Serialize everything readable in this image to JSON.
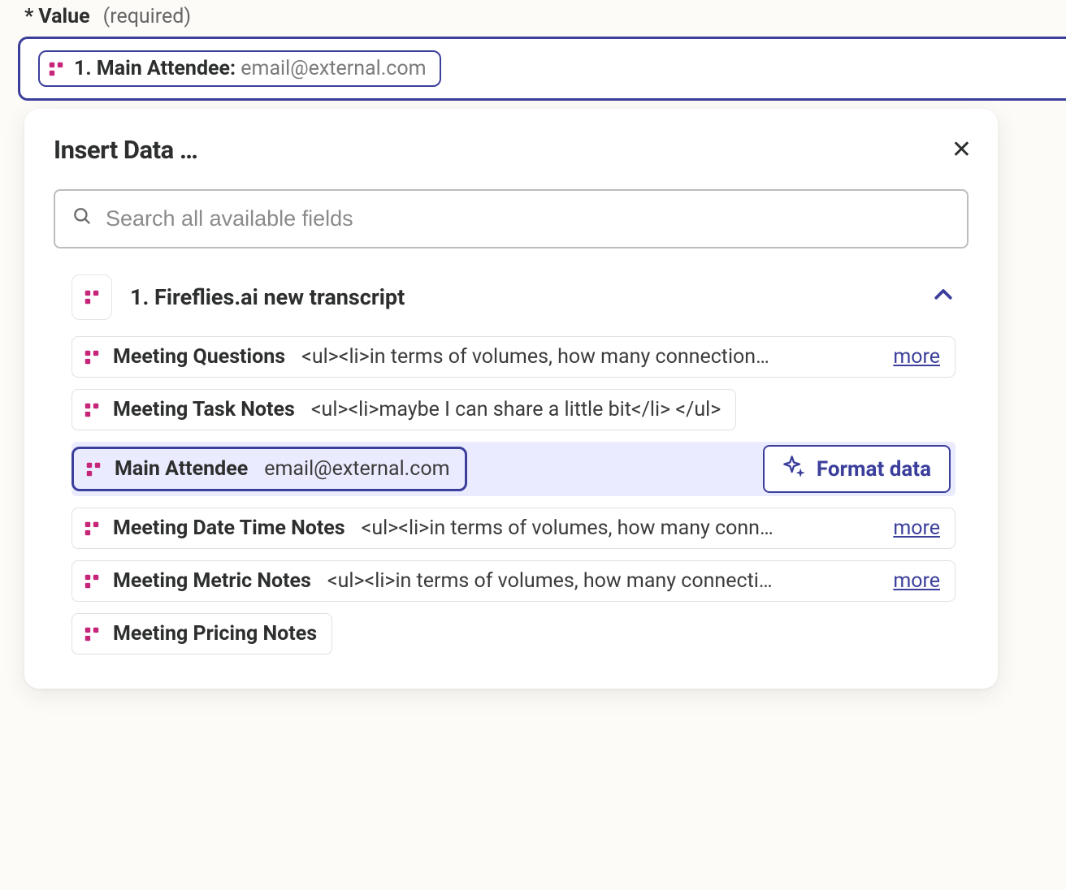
{
  "field": {
    "asterisk": "*",
    "label": "Value",
    "required_hint": "(required)"
  },
  "pill": {
    "prefix": "1. Main Attendee:",
    "value": "email@external.com"
  },
  "dropdown": {
    "title": "Insert Data …",
    "search_placeholder": "Search all available fields"
  },
  "source": {
    "title": "1. Fireflies.ai new transcript"
  },
  "more_label": "more",
  "format_btn": "Format data",
  "fields": [
    {
      "name": "Meeting Questions",
      "preview": "<ul><li>in terms of volumes, how many connection…",
      "more": true,
      "full": true
    },
    {
      "name": "Meeting Task Notes",
      "preview": "<ul><li>maybe I can share a little bit</li> </ul>",
      "more": false,
      "full": false
    },
    {
      "name": "Main Attendee",
      "preview": "email@external.com",
      "selected": true
    },
    {
      "name": "Meeting Date Time Notes",
      "preview": "<ul><li>in terms of volumes, how many conn…",
      "more": true,
      "full": true
    },
    {
      "name": "Meeting Metric Notes",
      "preview": "<ul><li>in terms of volumes, how many connecti…",
      "more": true,
      "full": true
    },
    {
      "name": "Meeting Pricing Notes",
      "preview": "",
      "more": false,
      "full": false
    }
  ]
}
